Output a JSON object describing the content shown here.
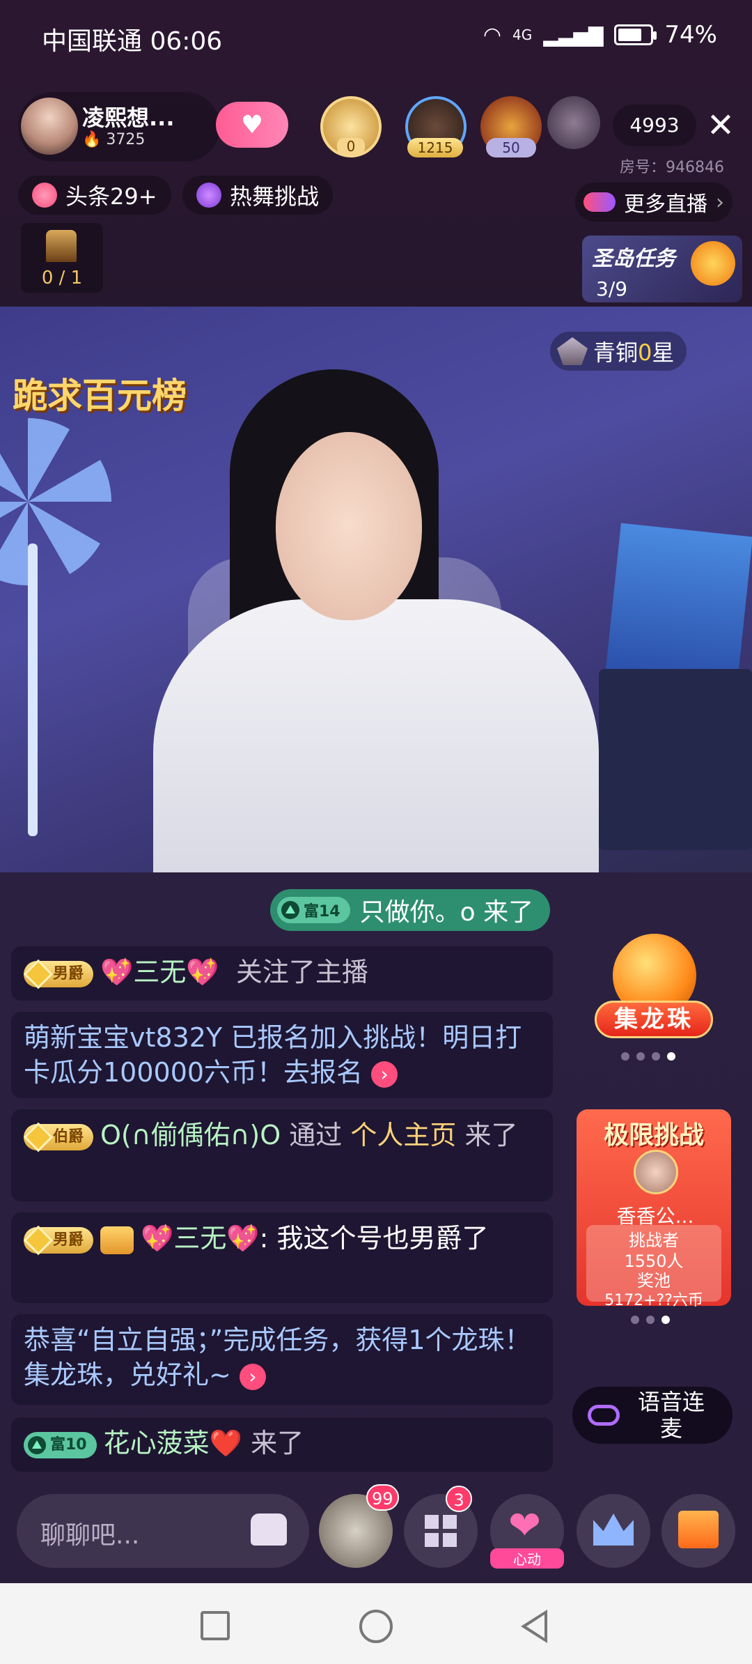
{
  "status_bar": {
    "carrier_time": "中国联通 06:06",
    "network": "4G",
    "battery": "74%",
    "battery_level": 0.74
  },
  "host": {
    "name": "凌熙想...",
    "heat": "3725"
  },
  "top_viewers": {
    "fan_level": "0",
    "viewer_1_badge": "1215",
    "viewer_2_badge": "50",
    "online_count": "4993",
    "room_number": "房号：946846"
  },
  "pills": {
    "headline": "头条29+",
    "dance": "热舞挑战",
    "more_live": "更多直播",
    "more_live_arrow": "›"
  },
  "chair": {
    "count": "0 / 1"
  },
  "task": {
    "title": "圣岛任务",
    "progress": "3/9"
  },
  "video": {
    "slogan": "跪求百元榜",
    "rank_label": "青铜",
    "rank_star_num": "0",
    "rank_star_unit": "星"
  },
  "entry_banner": {
    "level": "富14",
    "text": "只做你。o 来了"
  },
  "chat": [
    {
      "badge": "男爵",
      "nick": "💖三无💖",
      "text": "关注了主播"
    },
    {
      "text": "萌新宝宝vt832Y 已报名加入挑战！明日打卡瓜分100000六币！去报名",
      "go": "›"
    },
    {
      "badge": "伯爵",
      "nick": "O(∩偂偊佑∩)O",
      "pre": "通过",
      "link": "个人主页",
      "text": "来了"
    },
    {
      "badge": "男爵",
      "nick": "💖三无💖",
      "text": ": 我这个号也男爵了"
    },
    {
      "text": "恭喜“自立自强；”完成任务，获得1个龙珠！集龙珠，兑好礼~",
      "go": "›"
    },
    {
      "badge": "富10",
      "nick": "花心菠菜",
      "heart": "❤️",
      "text": "来了"
    }
  ],
  "side": {
    "dragon_label": "集龙珠",
    "challenge_title": "极限挑战",
    "challenge_name": "香香公...",
    "challenger_label": "挑战者",
    "challenger_count": "1550人",
    "pool_label": "奖池",
    "pool_value": "5172+??六币",
    "voice_label": "语音连麦"
  },
  "bottom": {
    "input_placeholder": "聊聊吧...",
    "badge_99": "99",
    "badge_3": "3",
    "heart_label": "心动"
  },
  "icons": {
    "close": "✕",
    "heart": "❤",
    "follow": "♥"
  }
}
